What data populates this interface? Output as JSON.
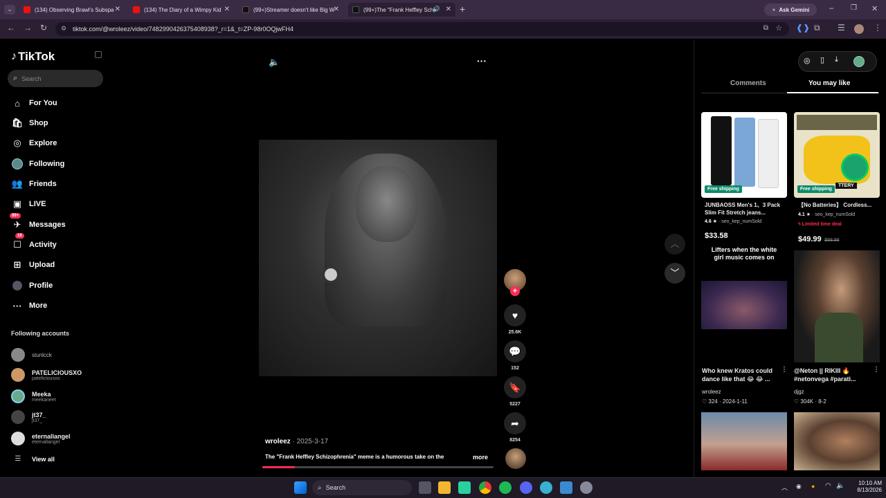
{
  "browser": {
    "tabs": [
      {
        "title": "(134) Observing Brawl's Subspa"
      },
      {
        "title": "(134) The Diary of a Wimpy Kid"
      },
      {
        "title": "(99+)Streamer doesn't like Big W"
      },
      {
        "title": "(99+)The \"Frank Heffley Schi"
      }
    ],
    "ask_gemini": "Ask Gemini",
    "url": "tiktok.com/@wroleez/video/7482990426375408938?_r=1&_t=ZP-98r0OQjwFH4"
  },
  "sidebar": {
    "logo": "TikTok",
    "search_placeholder": "Search",
    "nav": [
      {
        "label": "For You",
        "icon": "home-icon"
      },
      {
        "label": "Shop",
        "icon": "shop-icon"
      },
      {
        "label": "Explore",
        "icon": "compass-icon"
      },
      {
        "label": "Following",
        "icon": "following-icon"
      },
      {
        "label": "Friends",
        "icon": "friends-icon"
      },
      {
        "label": "LIVE",
        "icon": "live-icon"
      },
      {
        "label": "Messages",
        "icon": "messages-icon",
        "badge": "99+"
      },
      {
        "label": "Activity",
        "icon": "activity-icon",
        "badge": "16"
      },
      {
        "label": "Upload",
        "icon": "upload-icon"
      },
      {
        "label": "Profile",
        "icon": "profile-icon"
      },
      {
        "label": "More",
        "icon": "more-icon"
      }
    ],
    "following_title": "Following accounts",
    "accounts": [
      {
        "name": "stunlcck",
        "handle": ""
      },
      {
        "name": "PATELICIOUSXO",
        "handle": "pateliciousxo"
      },
      {
        "name": "Meeka",
        "handle": "meekaneet"
      },
      {
        "name": "jt37_",
        "handle": "jt37_"
      },
      {
        "name": "eternallangel",
        "handle": "eternallangel"
      }
    ],
    "view_all": "View all"
  },
  "video": {
    "author": "wroleez",
    "date": "2025-3-17",
    "caption": "The \"Frank Heffley Schizophrenia\" meme is a humorous take on the",
    "more": "more",
    "progress": 0.14,
    "likes": "25.6K",
    "comments": "152",
    "saves": "5227",
    "shares": "8254"
  },
  "right_panel": {
    "tabs": [
      "Comments",
      "You may like"
    ],
    "active_tab": "You may like",
    "products": [
      {
        "badge": "Free shipping",
        "title": "JUNBAOSS Men's 1、3 Pack Slim Fit Stretch jeans...",
        "rating": "4.6",
        "sold": "seo_kep_numSold",
        "price": "$33.58",
        "old_price": ""
      },
      {
        "badge": "Free shipping",
        "title": "【No Batteries】 Cordless...",
        "rating": "4.1",
        "sold": "seo_kep_numSold",
        "deal": "Limited time deal",
        "price": "$49.99",
        "old_price": "$99.99",
        "image_text": "TTERY"
      }
    ],
    "videos": [
      {
        "overlay": "Lifters when the white girl music comes on",
        "title": "Who knew Kratos could dance like that 😂 😂 ...",
        "author": "wroleez",
        "likes": "324",
        "date": "2024-1-11"
      },
      {
        "title": "@Neton || RIKIII 🔥 #netonvega #parati...",
        "author": "djgz",
        "likes": "304K",
        "date": "8-2"
      }
    ]
  },
  "taskbar": {
    "search": "Search",
    "time": "10:10 AM",
    "date": "8/13/2026"
  }
}
